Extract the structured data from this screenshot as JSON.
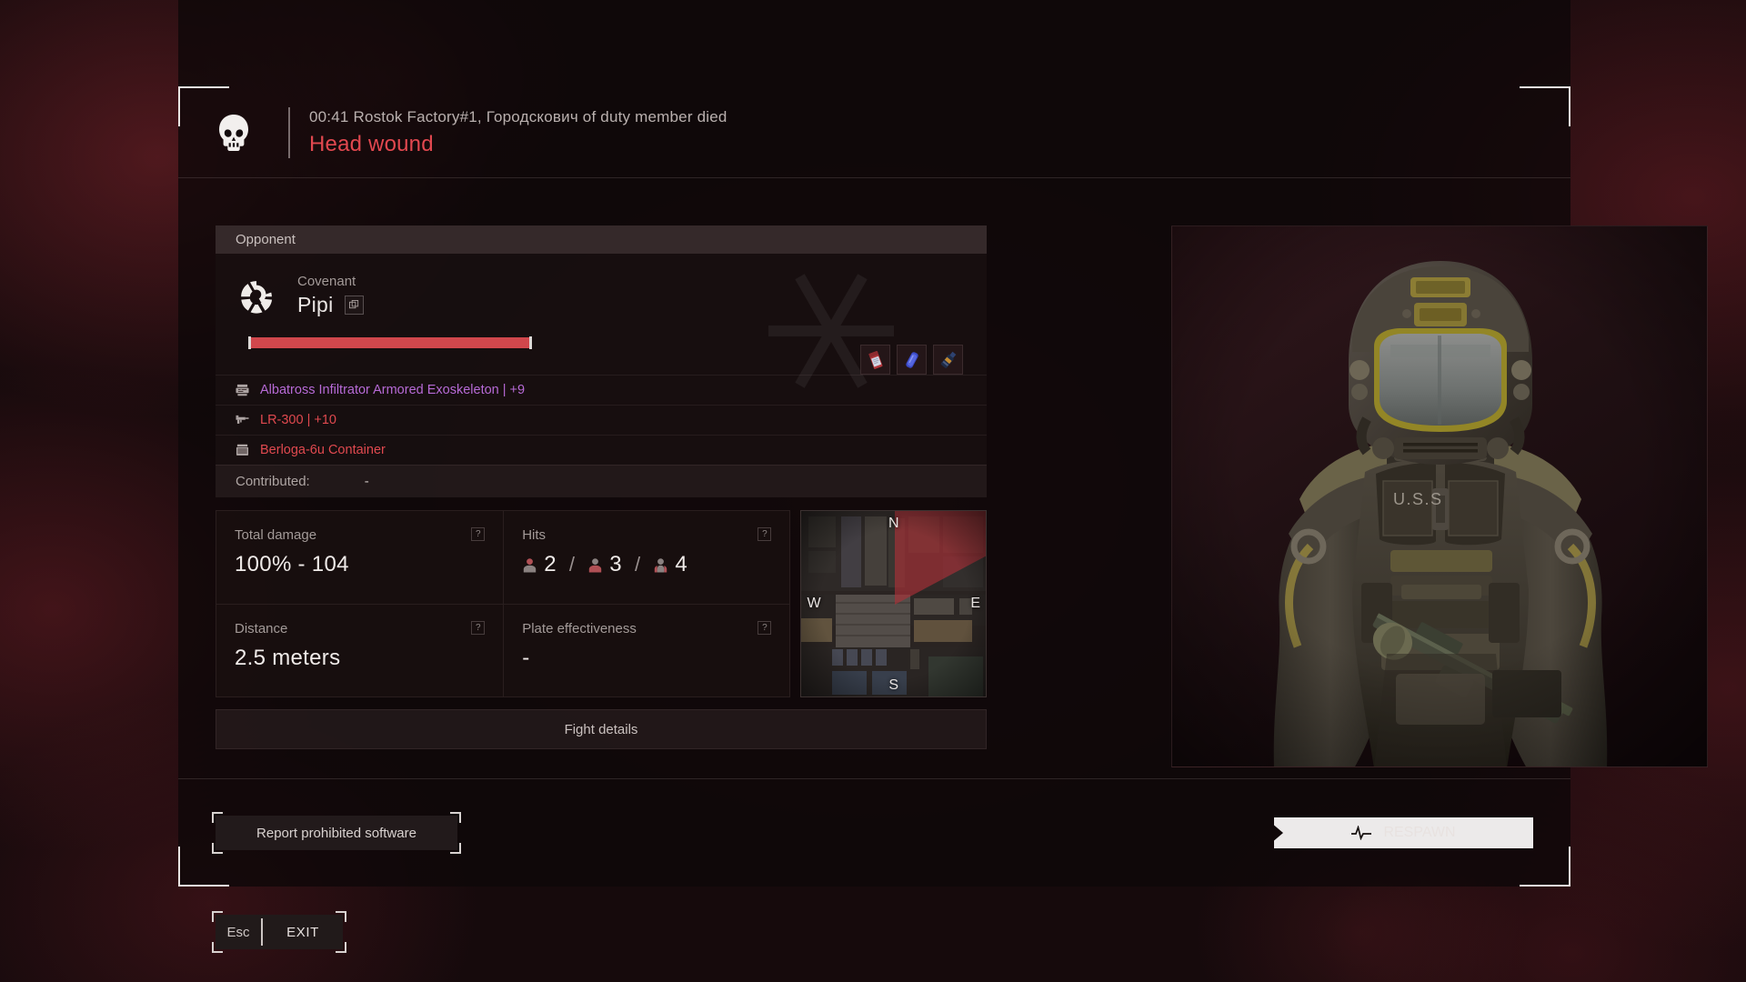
{
  "header": {
    "skull_icon": "skull-icon",
    "kill_line": "00:41 Rostok Factory#1, Городскович of duty member died",
    "wound": "Head wound",
    "wound_color": "#e1484f"
  },
  "opponent": {
    "section_label": "Opponent",
    "faction_icon": "covenant-faction-icon",
    "faction_label": "Covenant",
    "player_name": "Pipi",
    "copy_icon": "copy-icon",
    "health_percent": 100,
    "health_color": "#d0474c",
    "items": [
      {
        "icon": "red-canister-item-icon"
      },
      {
        "icon": "blue-can-item-icon"
      },
      {
        "icon": "dark-bottle-item-icon"
      }
    ],
    "gear": [
      {
        "icon": "armor-icon",
        "label": "Albatross Infiltrator Armored Exoskeleton | +9",
        "color": "#b76ad6"
      },
      {
        "icon": "weapon-icon",
        "label": "LR-300 | +10",
        "color": "#e0494f"
      },
      {
        "icon": "container-icon",
        "label": "Berloga-6u Container",
        "color": "#e0494f"
      }
    ],
    "contributed_label": "Contributed:",
    "contributed_value": "-"
  },
  "stats": [
    {
      "label": "Total damage",
      "value": "100% - 104",
      "help": "?"
    },
    {
      "label": "Hits",
      "help": "?",
      "hits": [
        {
          "icon": "hit-head-icon",
          "count": "2"
        },
        {
          "icon": "hit-body-icon",
          "count": "3"
        },
        {
          "icon": "hit-limb-icon",
          "count": "4"
        }
      ],
      "separator": "/"
    },
    {
      "label": "Distance",
      "value": "2.5 meters",
      "help": "?"
    },
    {
      "label": "Plate effectiveness",
      "value": "-",
      "help": "?"
    }
  ],
  "minimap": {
    "name": "tactical-minimap",
    "compass": {
      "n": "N",
      "s": "S",
      "w": "W",
      "e": "E"
    },
    "cone_color": "#b03038"
  },
  "fight_details_label": "Fight details",
  "portrait": {
    "name": "character-portrait",
    "chest_marking": "U.S.S"
  },
  "footer": {
    "report_label": "Report prohibited software",
    "respawn_label": "RESPAWN",
    "respawn_icon": "pulse-icon",
    "esc_key": "Esc",
    "exit_label": "EXIT"
  }
}
